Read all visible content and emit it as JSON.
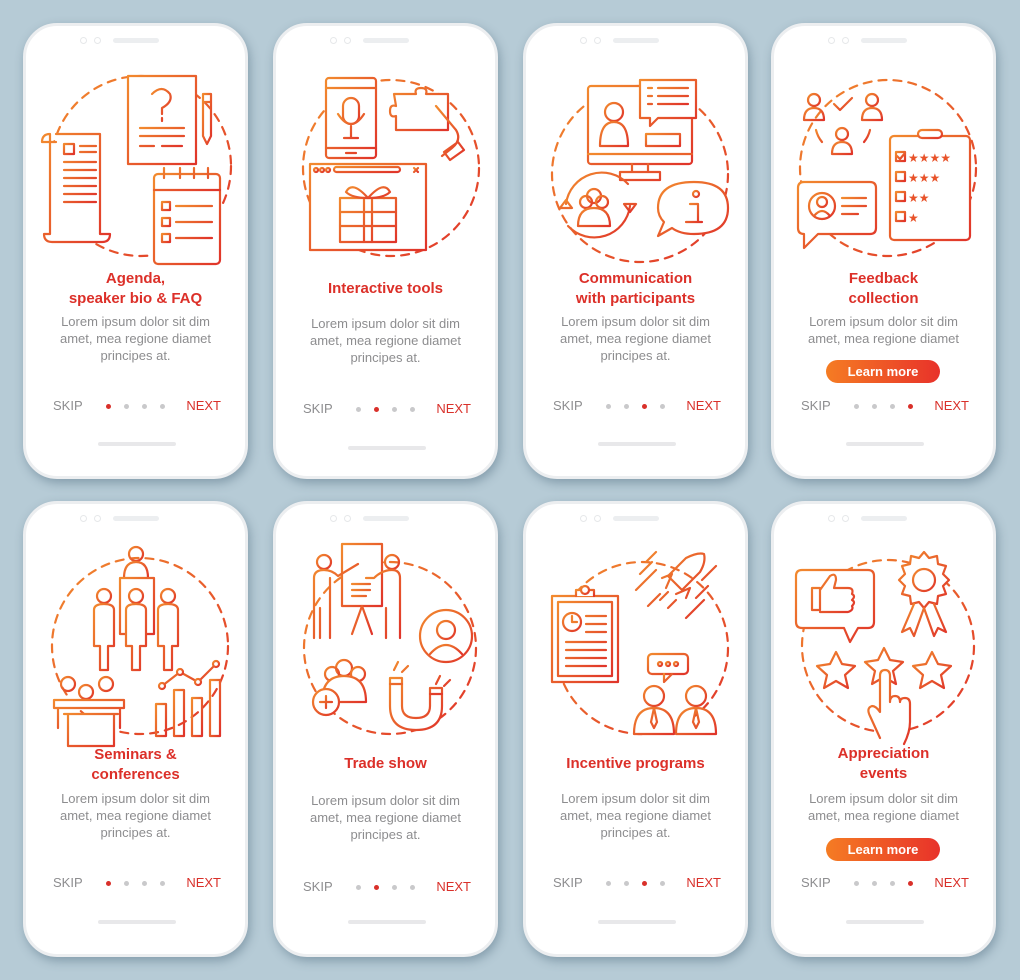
{
  "colors": {
    "background": "#b6cbd6",
    "title": "#dc3029",
    "body_text": "#8d8d8f",
    "accent_gradient_start": "#f57c23",
    "accent_gradient_end": "#e8322a",
    "dot_inactive": "#c9c9cb",
    "dot_active": "#d9302a"
  },
  "common": {
    "skip_label": "SKIP",
    "next_label": "NEXT",
    "learn_more_label": "Learn more",
    "description": "Lorem ipsum dolor sit dim amet, mea regione diamet principes at.",
    "description_short": "Lorem ipsum dolor sit dim amet, mea regione diamet"
  },
  "screens": [
    {
      "title_lines": [
        "Agenda,",
        "speaker bio & FAQ"
      ],
      "illustration": "documents-faq-calendar-icon",
      "active_page": 1,
      "total_pages": 4,
      "has_learn_more": false,
      "description_lines": [
        "Lorem ipsum dolor sit dim",
        "amet, mea regione diamet",
        "principes at."
      ]
    },
    {
      "title_lines": [
        "Interactive tools"
      ],
      "illustration": "phone-mic-puzzle-gift-icon",
      "active_page": 2,
      "total_pages": 4,
      "has_learn_more": false,
      "description_lines": [
        "Lorem ipsum dolor sit dim",
        "amet, mea regione diamet",
        "principes at."
      ]
    },
    {
      "title_lines": [
        "Communication",
        "with participants"
      ],
      "illustration": "monitor-chat-group-info-icon",
      "active_page": 3,
      "total_pages": 4,
      "has_learn_more": false,
      "description_lines": [
        "Lorem ipsum dolor sit dim",
        "amet, mea regione diamet",
        "principes at."
      ]
    },
    {
      "title_lines": [
        "Feedback",
        "collection"
      ],
      "illustration": "survey-rating-stars-icon",
      "active_page": 4,
      "total_pages": 4,
      "has_learn_more": true,
      "description_lines": [
        "Lorem ipsum dolor sit dim",
        "amet, mea regione diamet"
      ]
    },
    {
      "title_lines": [
        "Seminars &",
        "conferences"
      ],
      "illustration": "audience-speaker-chart-icon",
      "active_page": 1,
      "total_pages": 4,
      "has_learn_more": false,
      "description_lines": [
        "Lorem ipsum dolor sit dim",
        "amet, mea regione diamet",
        "principes at."
      ]
    },
    {
      "title_lines": [
        "Trade show"
      ],
      "illustration": "presentation-magnet-people-icon",
      "active_page": 2,
      "total_pages": 4,
      "has_learn_more": false,
      "description_lines": [
        "Lorem ipsum dolor sit dim",
        "amet, mea regione diamet",
        "principes at."
      ]
    },
    {
      "title_lines": [
        "Incentive programs"
      ],
      "illustration": "clipboard-rocket-businessmen-icon",
      "active_page": 3,
      "total_pages": 4,
      "has_learn_more": false,
      "description_lines": [
        "Lorem ipsum dolor sit dim",
        "amet, mea regione diamet",
        "principes at."
      ]
    },
    {
      "title_lines": [
        "Appreciation",
        "events"
      ],
      "illustration": "thumbs-up-award-stars-icon",
      "active_page": 4,
      "total_pages": 4,
      "has_learn_more": true,
      "description_lines": [
        "Lorem ipsum dolor sit dim",
        "amet, mea regione diamet"
      ]
    }
  ]
}
